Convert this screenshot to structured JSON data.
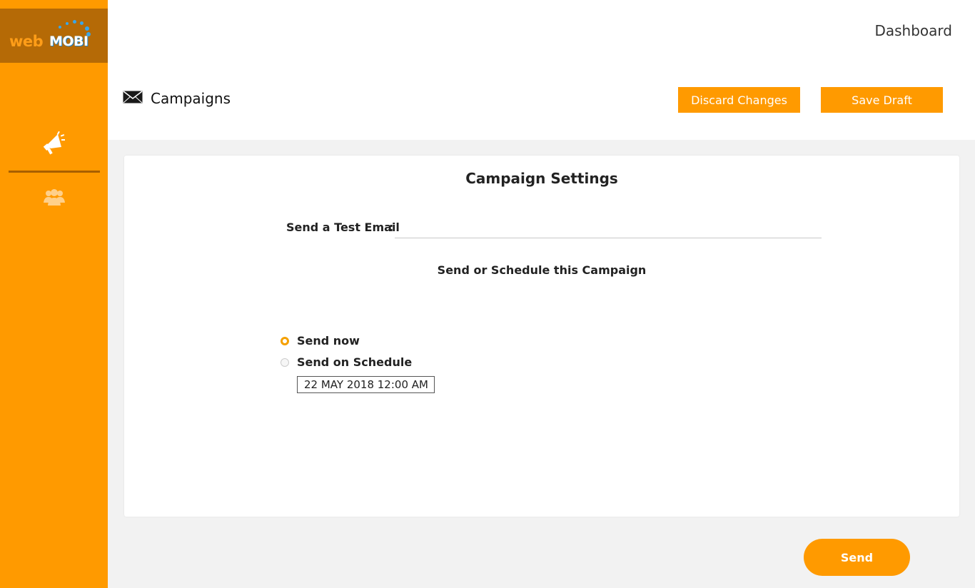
{
  "brand": {
    "logo_text_web": "web",
    "logo_text_mobi": "MOBI"
  },
  "sidebar": {
    "items": [
      {
        "icon": "megaphone-icon",
        "name": "campaigns"
      },
      {
        "icon": "users-icon",
        "name": "contacts"
      }
    ]
  },
  "header": {
    "dashboard_link": "Dashboard",
    "page_title": "Campaigns",
    "discard_label": "Discard Changes",
    "save_label": "Save Draft"
  },
  "settings": {
    "title": "Campaign Settings",
    "test_email_label": "Send a Test Email",
    "test_email_colon": ":",
    "test_email_value": "",
    "schedule_heading": "Send or Schedule this Campaign",
    "options": [
      {
        "label": "Send now",
        "selected": true
      },
      {
        "label": "Send on Schedule",
        "selected": false
      }
    ],
    "schedule_datetime": "22 MAY 2018 12:00 AM"
  },
  "footer": {
    "send_label": "Send"
  },
  "colors": {
    "accent": "#ff9a00",
    "logo_bg": "#b56a06",
    "page_bg": "#f2f2f2"
  }
}
